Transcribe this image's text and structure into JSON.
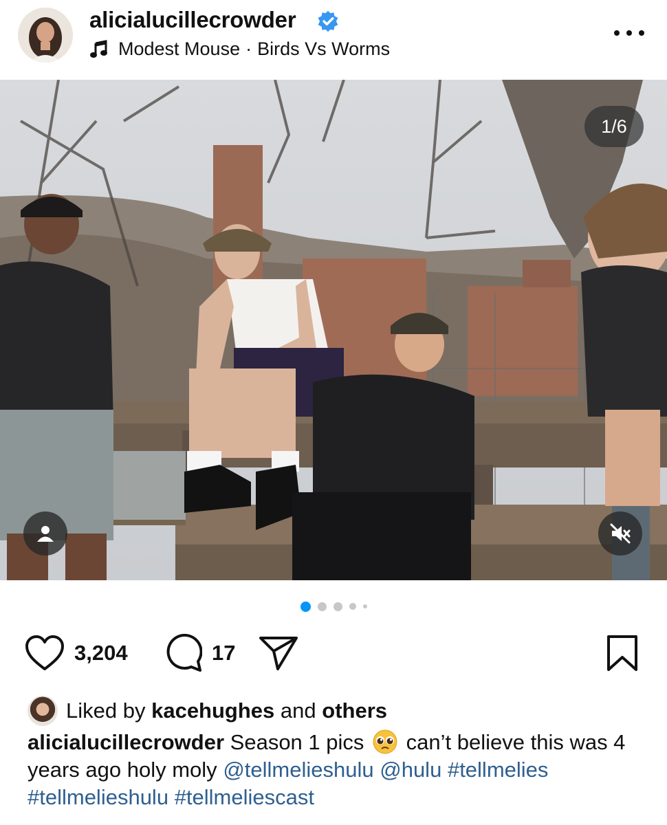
{
  "header": {
    "username": "alicialucillecrowder",
    "music_artist": "Modest Mouse",
    "music_separator": "·",
    "music_track": "Birds Vs Worms",
    "verified_color": "#3897f0"
  },
  "photo": {
    "counter": "1/6",
    "current_index": 1,
    "total": 6
  },
  "pagination": {
    "active": 0,
    "visible_dots": 5,
    "active_color": "#0095f6"
  },
  "actions": {
    "like_count": "3,204",
    "comment_count": "17",
    "icons": [
      "heart-icon",
      "comment-icon",
      "share-icon",
      "bookmark-icon"
    ]
  },
  "likes": {
    "prefix": "Liked by",
    "user": "kacehughes",
    "conjunction": "and",
    "others": "others"
  },
  "caption": {
    "author": "alicialucillecrowder",
    "text1": "Season 1 pics",
    "text2": "can’t believe this was 4 years ago holy moly",
    "mention1": "@tellmelieshulu",
    "mention2": "@hulu",
    "hashtag1": "#tellmelies",
    "hashtag2": "#tellmelieshulu",
    "hashtag3": "#tellmeliescast"
  }
}
